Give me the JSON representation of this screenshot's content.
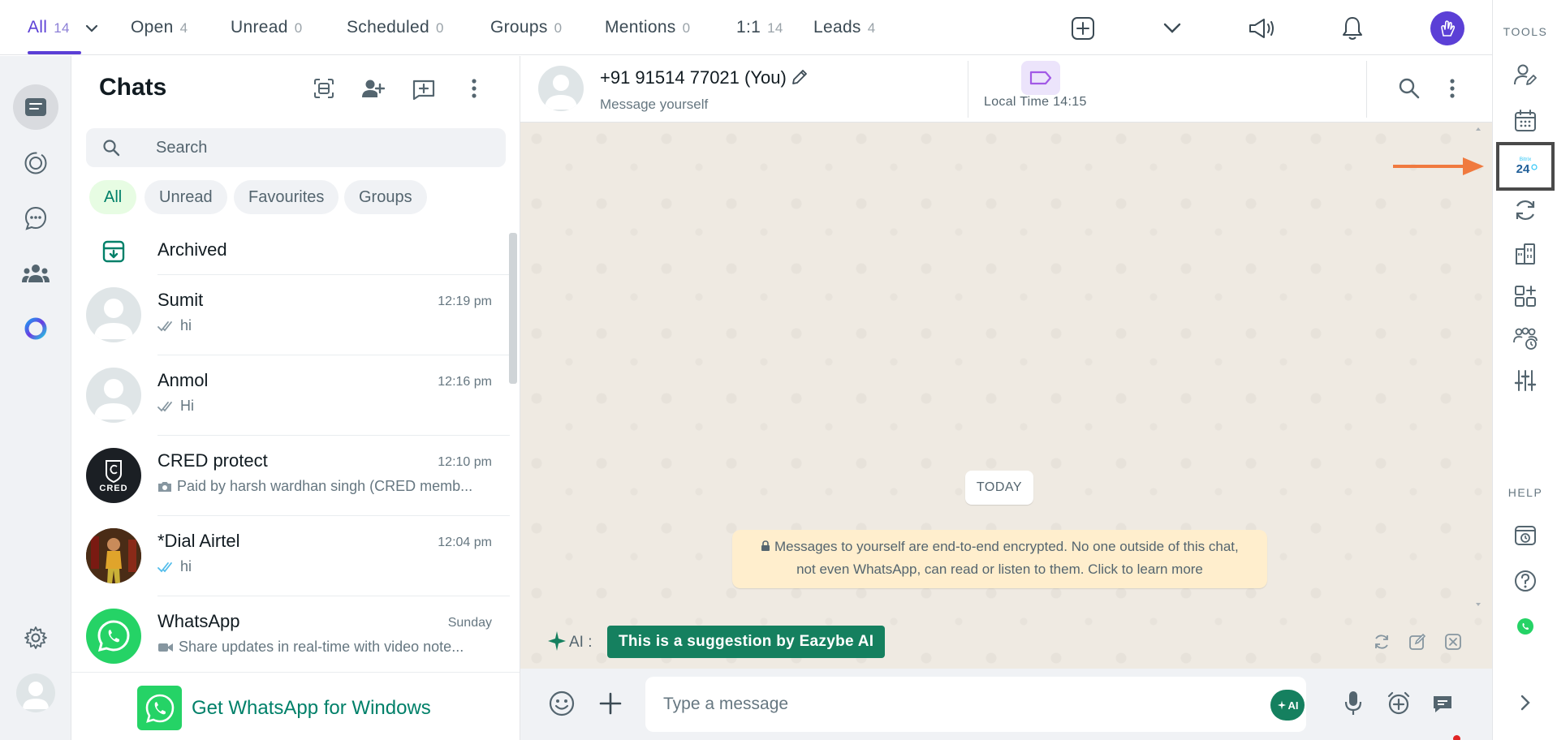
{
  "topbar": {
    "tabs": [
      {
        "label": "All",
        "count": "14"
      },
      {
        "label": "Open",
        "count": "4"
      },
      {
        "label": "Unread",
        "count": "0"
      },
      {
        "label": "Scheduled",
        "count": "0"
      },
      {
        "label": "Groups",
        "count": "0"
      },
      {
        "label": "Mentions",
        "count": "0"
      },
      {
        "label": "1:1",
        "count": "14"
      },
      {
        "label": "Leads",
        "count": "4"
      }
    ],
    "icons": [
      "add-square-icon",
      "chevron-down-icon",
      "megaphone-icon",
      "bell-icon",
      "user-avatar-icon"
    ]
  },
  "rail": {
    "icons": [
      "chats-icon",
      "status-icon",
      "channels-icon",
      "communities-icon",
      "meta-ai-icon",
      "settings-icon",
      "profile-icon"
    ]
  },
  "chatlist": {
    "title": "Chats",
    "search_placeholder": "Search",
    "chips": [
      "All",
      "Unread",
      "Favourites",
      "Groups"
    ],
    "archived_label": "Archived",
    "chats": [
      {
        "name": "Sumit",
        "time": "12:19 pm",
        "preview": "hi",
        "tick": "read-grey"
      },
      {
        "name": "Anmol",
        "time": "12:16 pm",
        "preview": "Hi",
        "tick": "read-grey"
      },
      {
        "name": "CRED protect",
        "time": "12:10 pm",
        "preview": "Paid by harsh wardhan singh (CRED memb...",
        "tick": "camera",
        "avatar_text": "CRED"
      },
      {
        "name": "*Dial Airtel",
        "time": "12:04 pm",
        "preview": "hi",
        "tick": "read-blue"
      },
      {
        "name": "WhatsApp",
        "time": "Sunday",
        "preview": "Share updates in real-time with video note...",
        "tick": "video"
      }
    ],
    "get_whatsapp": "Get WhatsApp for Windows"
  },
  "conversation": {
    "name": "+91 91514 77021 (You)",
    "subtitle": "Message yourself",
    "local_time": "Local Time 14:15",
    "day_label": "TODAY",
    "encryption_line1": "Messages to yourself are end-to-end encrypted. No one outside of this chat,",
    "encryption_line2": "not even WhatsApp, can read or listen to them. Click to learn more",
    "ai_label": "AI :",
    "ai_suggestion": "This is a suggestion by Eazybe AI",
    "composer_placeholder": "Type a message",
    "ai_button": "AI"
  },
  "tools": {
    "heading": "TOOLS",
    "help_heading": "HELP",
    "badge_24_top": "Bitrix",
    "badge_24": "24"
  },
  "colors": {
    "accent_purple": "#5b3fd6",
    "whatsapp_green": "#25d366",
    "eazybe_green": "#15805f",
    "arrow_orange": "#f07a3f"
  }
}
